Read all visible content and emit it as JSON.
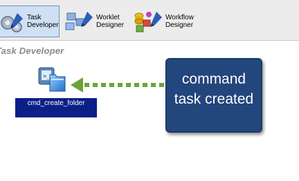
{
  "toolbar": {
    "task_developer": {
      "line1": "Task",
      "line2": "Developer"
    },
    "worklet_designer": {
      "line1": "Worklet",
      "line2": "Designer"
    },
    "workflow_designer": {
      "line1": "Workflow",
      "line2": "Designer"
    }
  },
  "canvas": {
    "title": "Task Developer",
    "task": {
      "label": "cmd_create_folder",
      "icon": "command-task-icon"
    }
  },
  "annotation": {
    "line1": "command",
    "line2": "task created"
  },
  "colors": {
    "task_label_bg": "#0b1f87",
    "callout_bg": "#23467c",
    "arrow": "#6aa339"
  }
}
